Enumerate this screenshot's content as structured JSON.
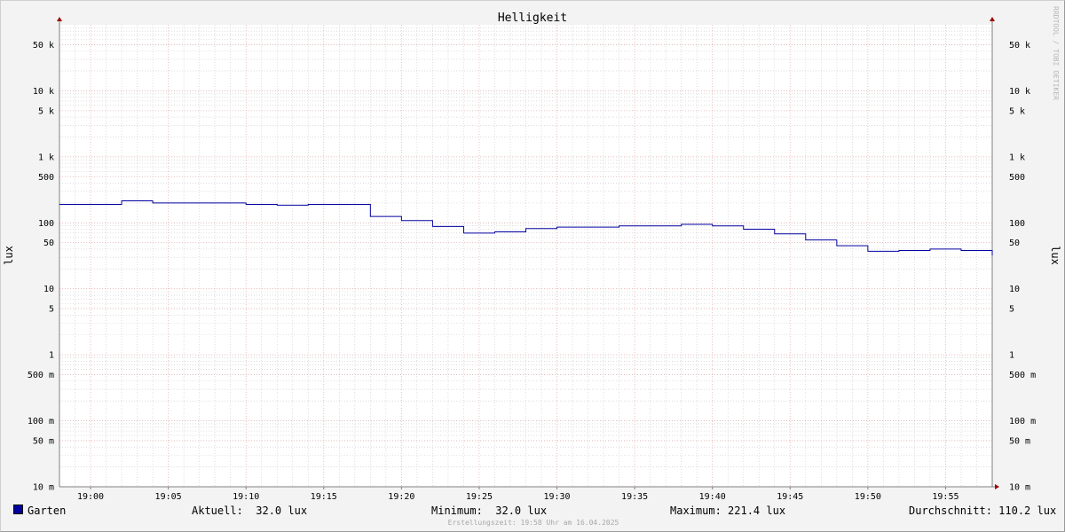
{
  "chart_data": {
    "type": "line",
    "title": "Helligkeit",
    "ylabel": "lux",
    "xlabel": "",
    "y_scale": "log",
    "ylim": [
      0.01,
      100000
    ],
    "y_ticks": [
      {
        "value": 50000,
        "label": "50 k"
      },
      {
        "value": 10000,
        "label": "10 k"
      },
      {
        "value": 5000,
        "label": "5 k"
      },
      {
        "value": 1000,
        "label": "1 k"
      },
      {
        "value": 500,
        "label": "500"
      },
      {
        "value": 100,
        "label": "100"
      },
      {
        "value": 50,
        "label": "50"
      },
      {
        "value": 10,
        "label": "10"
      },
      {
        "value": 5,
        "label": "5"
      },
      {
        "value": 1,
        "label": "1"
      },
      {
        "value": 0.5,
        "label": "500 m"
      },
      {
        "value": 0.1,
        "label": "100 m"
      },
      {
        "value": 0.05,
        "label": "50 m"
      },
      {
        "value": 0.01,
        "label": "10 m"
      }
    ],
    "x_ticks": [
      "19:00",
      "19:05",
      "19:10",
      "19:15",
      "19:20",
      "19:25",
      "19:30",
      "19:35",
      "19:40",
      "19:45",
      "19:50",
      "19:55"
    ],
    "x_range": [
      "18:58",
      "19:58"
    ],
    "grid": true,
    "legend_position": "bottom",
    "series": [
      {
        "name": "Garten",
        "color": "#0000a0",
        "step": true,
        "points": [
          [
            "18:58",
            190
          ],
          [
            "19:00",
            190
          ],
          [
            "19:02",
            215
          ],
          [
            "19:04",
            200
          ],
          [
            "19:06",
            200
          ],
          [
            "19:08",
            200
          ],
          [
            "19:10",
            190
          ],
          [
            "19:12",
            185
          ],
          [
            "19:14",
            190
          ],
          [
            "19:16",
            190
          ],
          [
            "19:18",
            125
          ],
          [
            "19:20",
            108
          ],
          [
            "19:22",
            88
          ],
          [
            "19:24",
            70
          ],
          [
            "19:26",
            73
          ],
          [
            "19:28",
            82
          ],
          [
            "19:30",
            86
          ],
          [
            "19:32",
            86
          ],
          [
            "19:34",
            90
          ],
          [
            "19:36",
            90
          ],
          [
            "19:38",
            95
          ],
          [
            "19:40",
            90
          ],
          [
            "19:42",
            80
          ],
          [
            "19:44",
            68
          ],
          [
            "19:46",
            55
          ],
          [
            "19:48",
            45
          ],
          [
            "19:50",
            37
          ],
          [
            "19:52",
            38
          ],
          [
            "19:54",
            40
          ],
          [
            "19:56",
            38
          ],
          [
            "19:58",
            32
          ]
        ]
      }
    ]
  },
  "legend": {
    "series_name": "Garten",
    "current": "Aktuell:  32.0 lux",
    "minimum": "Minimum:  32.0 lux",
    "maximum": "Maximum: 221.4 lux",
    "average": "Durchschnitt: 110.2 lux"
  },
  "watermark": "RRDTOOL / TOBI OETIKER",
  "footer": "Erstellungszeit: 19:58 Uhr am 16.04.2025",
  "colors": {
    "series": "#0000a0",
    "major_grid": "#e8a4a4",
    "minor_grid": "#c8c8c8",
    "axis": "#808080",
    "arrow": "#a00000",
    "canvas": "#ffffff",
    "background": "#f3f3f3"
  }
}
